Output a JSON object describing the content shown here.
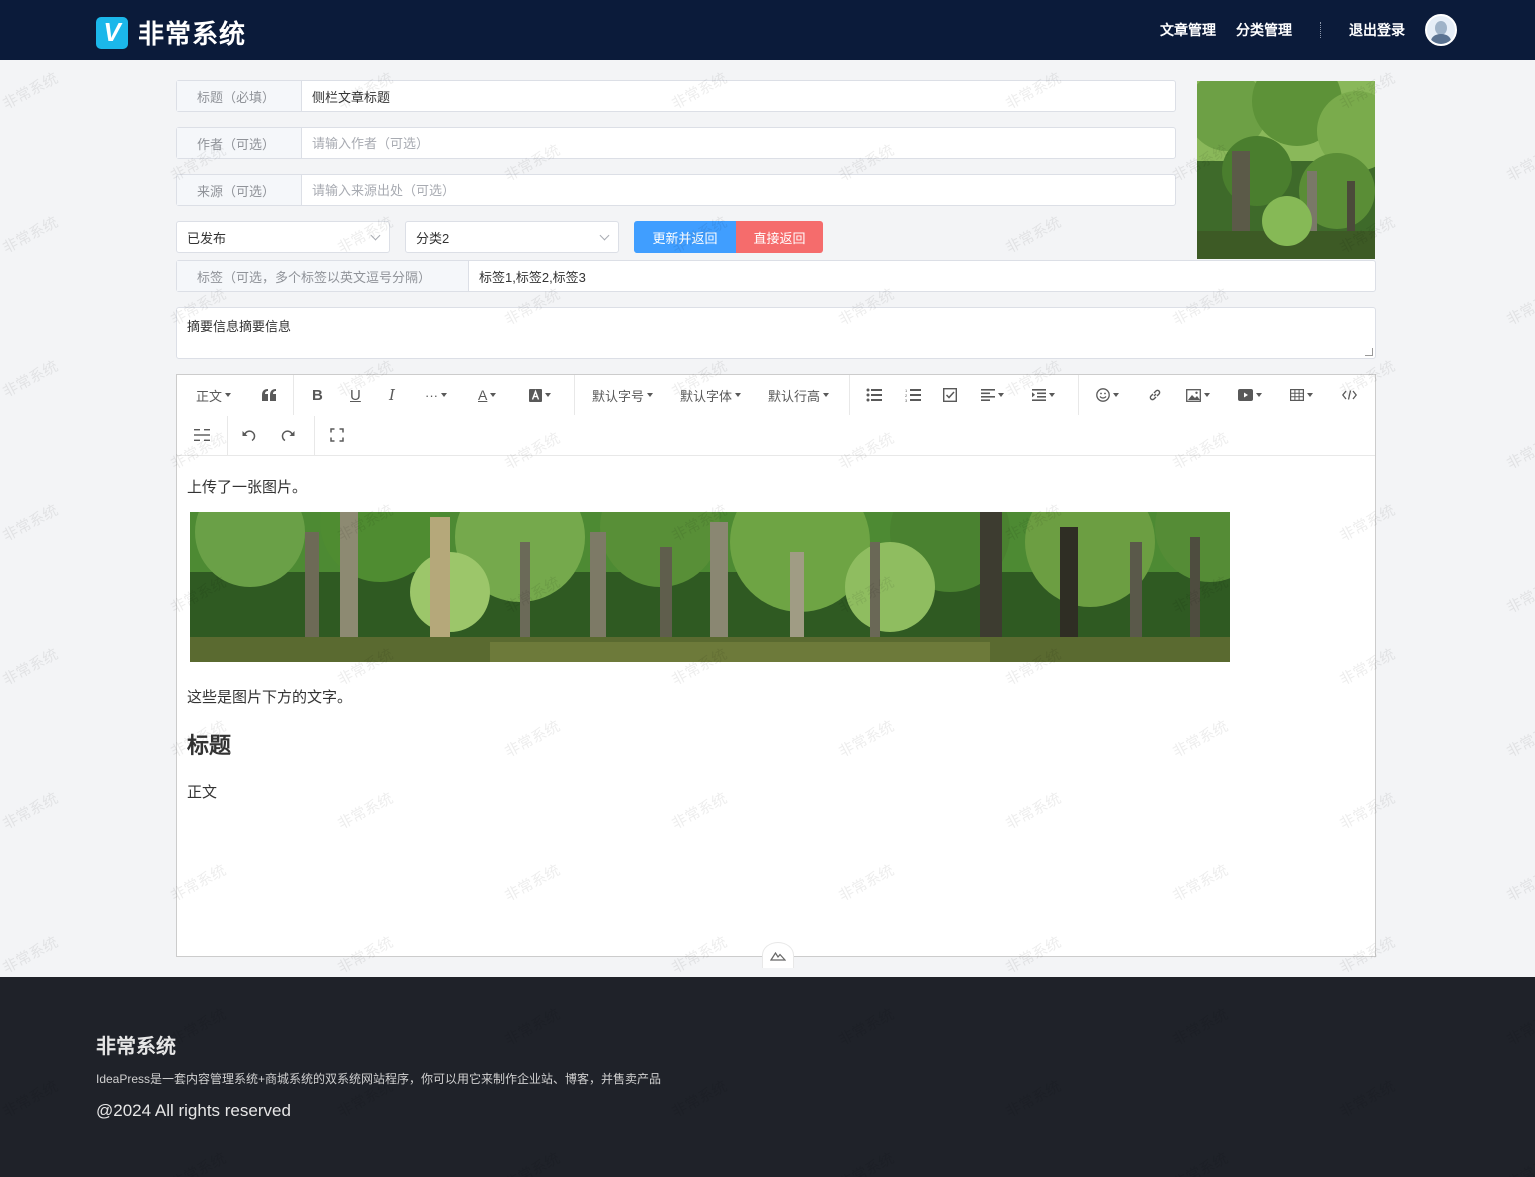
{
  "header": {
    "brand_letter": "V",
    "brand_name": "非常系统",
    "nav": {
      "articles": "文章管理",
      "categories": "分类管理",
      "logout": "退出登录"
    }
  },
  "form": {
    "title": {
      "label": "标题（必填）",
      "value": "侧栏文章标题"
    },
    "author": {
      "label": "作者（可选）",
      "placeholder": "请输入作者（可选）"
    },
    "source": {
      "label": "来源（可选）",
      "placeholder": "请输入来源出处（可选）"
    },
    "status_select": "已发布",
    "category_select": "分类2",
    "update_button": "更新并返回",
    "back_button": "直接返回",
    "tags": {
      "label": "标签（可选，多个标签以英文逗号分隔）",
      "value": "标签1,标签2,标签3"
    },
    "summary": "摘要信息摘要信息"
  },
  "toolbar": {
    "paragraph": "正文",
    "font_size": "默认字号",
    "font_family": "默认字体",
    "line_height": "默认行高"
  },
  "editor_content": {
    "p1": "上传了一张图片。",
    "p2": "这些是图片下方的文字。",
    "heading": "标题",
    "p3": "正文"
  },
  "watermark": "非常系统",
  "footer": {
    "title": "非常系统",
    "description": "IdeaPress是一套内容管理系统+商城系统的双系统网站程序，你可以用它来制作企业站、博客，并售卖产品",
    "copyright": "@2024 All rights reserved"
  },
  "colors": {
    "header_bg": "#0b1b3a",
    "brand_accent": "#1bb7ea",
    "primary_button": "#409eff",
    "danger_button": "#f56c6c",
    "footer_bg": "#1f2229"
  }
}
